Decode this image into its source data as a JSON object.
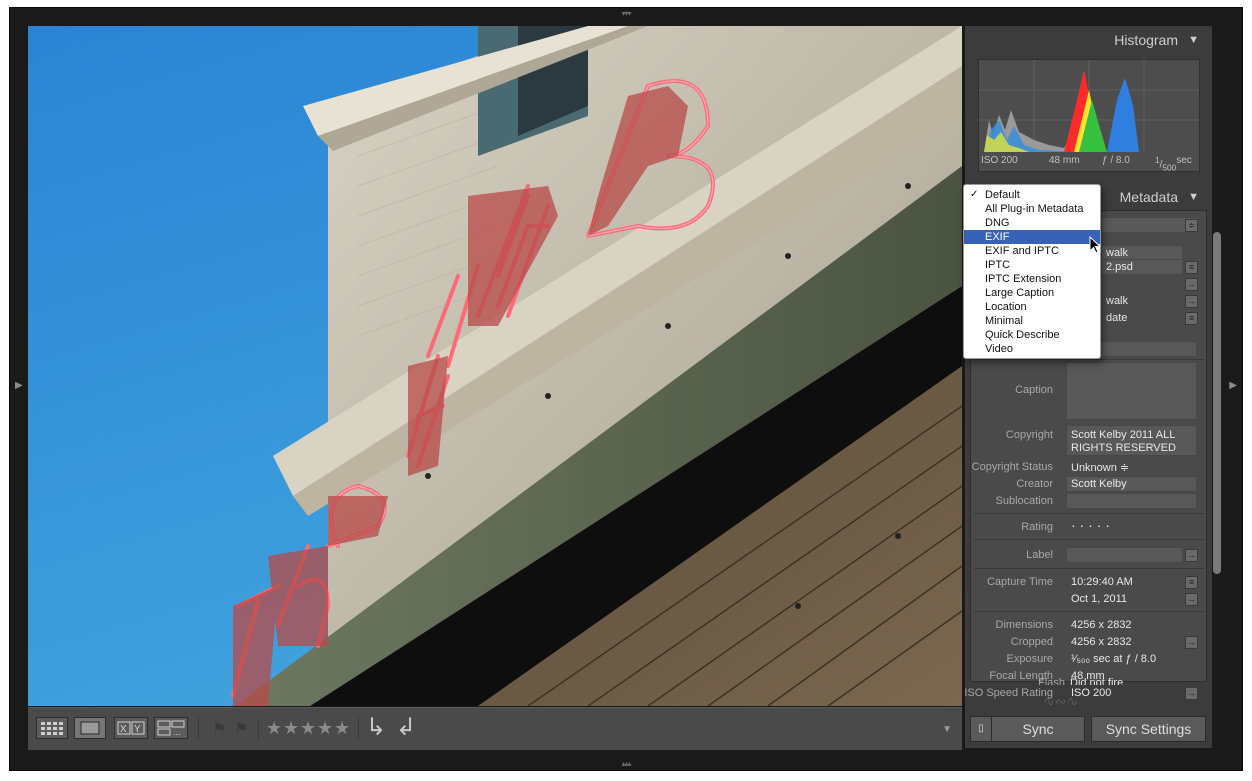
{
  "histogram": {
    "title": "Histogram",
    "iso": "ISO 200",
    "focal": "48 mm",
    "aperture": "ƒ / 8.0",
    "shutter_num": "1",
    "shutter_den": "500",
    "shutter_unit": "sec"
  },
  "metadata": {
    "title": "Metadata",
    "preset_dropdown": {
      "items": [
        "Default",
        "All Plug-in Metadata",
        "DNG",
        "EXIF",
        "EXIF and IPTC",
        "IPTC",
        "IPTC Extension",
        "Large Caption",
        "Location",
        "Minimal",
        "Quick Describe",
        "Video"
      ],
      "checked": "Default",
      "highlighted": "EXIF"
    },
    "partial_values": {
      "folder": "walk",
      "filename": "2.psd",
      "copy_name": "walk",
      "status": "date"
    },
    "fields": {
      "caption_label": "Caption",
      "copyright_label": "Copyright",
      "copyright_value_1": "Scott Kelby 2011 ALL",
      "copyright_value_2": "RIGHTS RESERVED",
      "copyright_status_label": "Copyright Status",
      "copyright_status_value": "Unknown ≑",
      "creator_label": "Creator",
      "creator_value": "Scott Kelby",
      "sublocation_label": "Sublocation",
      "rating_label": "Rating",
      "rating_value": "·  ·  ·  ·  ·",
      "label_label": "Label",
      "capture_time_label": "Capture Time",
      "capture_time_value": "10:29:40 AM",
      "capture_date_value": "Oct 1, 2011",
      "dimensions_label": "Dimensions",
      "dimensions_value": "4256 x 2832",
      "cropped_label": "Cropped",
      "cropped_value": "4256 x 2832",
      "exposure_label": "Exposure",
      "exposure_value": "¹⁄₅₀₀ sec at ƒ / 8.0",
      "focal_length_label": "Focal Length",
      "focal_length_value": "48 mm",
      "iso_label": "ISO Speed Rating",
      "iso_value": "ISO 200",
      "flash_label": "Flash",
      "flash_value": "Did not fire"
    }
  },
  "sync": {
    "sync_label": "Sync",
    "sync_settings_label": "Sync Settings"
  },
  "toolbar": {
    "icons": [
      "grid-view-icon",
      "loupe-view-icon",
      "compare-view-icon",
      "survey-view-icon",
      "flag-pick-icon",
      "flag-reject-icon",
      "rotate-left-icon",
      "rotate-right-icon"
    ]
  },
  "colors": {
    "panel_bg": "#3c3c3c",
    "window_bg": "#1a1a1a",
    "dropdown_highlight": "#3862b8",
    "sky": "#2d86cf",
    "neon": "#e0485a"
  }
}
